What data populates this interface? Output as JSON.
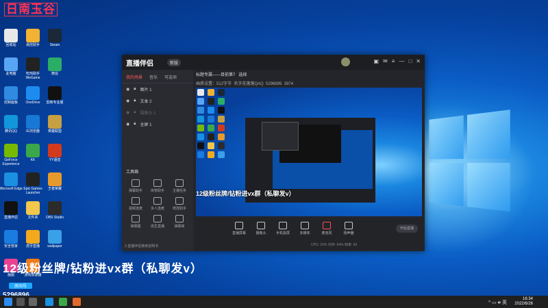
{
  "brand_watermark": "日南玉谷",
  "desktop_icons": [
    {
      "label": "回收站",
      "color": "#e8e8e8"
    },
    {
      "label": "易控助手",
      "color": "#f2b233"
    },
    {
      "label": "Steam",
      "color": "#1b2838"
    },
    {
      "label": "此电脑",
      "color": "#59a5f5"
    },
    {
      "label": "吃鸡助手 WeGame",
      "color": "#222"
    },
    {
      "label": "微信",
      "color": "#2aae67"
    },
    {
      "label": "控制面板",
      "color": "#2f8ae0"
    },
    {
      "label": "OneDrive",
      "color": "#1c8cf0"
    },
    {
      "label": "剪映专业版",
      "color": "#111"
    },
    {
      "label": "腾讯QQ",
      "color": "#1296db"
    },
    {
      "label": "IE浏览器",
      "color": "#1878d6"
    },
    {
      "label": "英雄联盟",
      "color": "#c7a043"
    },
    {
      "label": "GeForce Experience",
      "color": "#76b900"
    },
    {
      "label": "KK",
      "color": "#3aa84a"
    },
    {
      "label": "YY语音",
      "color": "#d23a1d"
    },
    {
      "label": "Microsoft Edge",
      "color": "#1b8fe0"
    },
    {
      "label": "Epic Games Launcher",
      "color": "#222"
    },
    {
      "label": "王者荣耀",
      "color": "#e69a2b"
    },
    {
      "label": "直播伴侣",
      "color": "#111"
    },
    {
      "label": "文件夹",
      "color": "#f1c84b"
    },
    {
      "label": "OBS Studio",
      "color": "#2b2b2b"
    },
    {
      "label": "安全管家",
      "color": "#1a7be0"
    },
    {
      "label": "虎牙直播",
      "color": "#f2a91e"
    },
    {
      "label": "wallpaper",
      "color": "#3aa0e8"
    },
    {
      "label": "画图",
      "color": "#e84393"
    },
    {
      "label": "游戏加速器",
      "color": "#f07a1a"
    }
  ],
  "app": {
    "title": "直播伴侣",
    "badge": "新版",
    "sidebar_tabs": [
      "我的场景",
      "音乐",
      "可选项"
    ],
    "layers": [
      {
        "name": "图片 1"
      },
      {
        "name": "文本 2"
      },
      {
        "name": "摄像头 1"
      },
      {
        "name": "全屏 1"
      }
    ],
    "tools_title": "工具箱",
    "tools": [
      "弹幕助手",
      "房管助手",
      "主播任务",
      "视频连麦",
      "多人连麦",
      "修改助手",
      "弹幕图",
      "逃生直播",
      "弹幕库"
    ],
    "sidebar_footer": "2.直播伴侣使用说明书",
    "room_title": "标题专属——目前第7",
    "edit_label": "选择",
    "stream_info": "画质设置：512字节",
    "account": "名字花落落QAQ",
    "room_id": "5296895",
    "fans": "3974",
    "stage_overlay": "12级粉丝牌/钻粉进vx群（私聊发v）",
    "bottom_buttons": [
      "直播屏幕",
      "摄像头",
      "手机投屏",
      "多媒体",
      "麦克风",
      "扬声器"
    ],
    "start_button": "开始直播",
    "status_text": "CPU: 15% 内存: 64% 帧率: 60"
  },
  "desktop_caption": "12级粉丝牌/钻粉进vx群（私聊发v）",
  "id_label": "房间号",
  "id_number": "5296896",
  "taskbar": {
    "time": "16:34",
    "date": "2022/6/26"
  }
}
